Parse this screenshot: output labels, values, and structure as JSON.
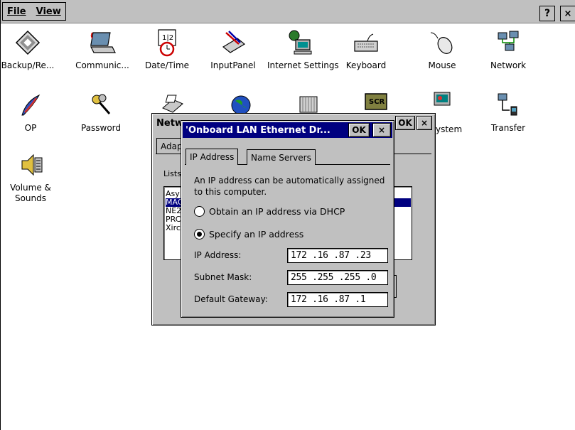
{
  "menubar": {
    "menus": [
      "File",
      "View"
    ],
    "help_label": "?",
    "close_label": "×"
  },
  "desktop_icons": [
    {
      "label": "Backup/Re...",
      "icon": "floppy-disk-icon"
    },
    {
      "label": "Communic...",
      "icon": "laptop-icon"
    },
    {
      "label": "Date/Time",
      "icon": "calendar-clock-icon"
    },
    {
      "label": "InputPanel",
      "icon": "keyboard-pen-icon"
    },
    {
      "label": "Internet Settings",
      "icon": "globe-computer-icon"
    },
    {
      "label": "Keyboard",
      "icon": "keyboard-icon"
    },
    {
      "label": "Mouse",
      "icon": "mouse-icon"
    },
    {
      "label": "Network",
      "icon": "network-computers-icon"
    },
    {
      "label": "OP",
      "icon": "feather-icon"
    },
    {
      "label": "Password",
      "icon": "keys-icon"
    },
    {
      "label": "Transfer",
      "icon": "pc-connection-icon"
    },
    {
      "label": "Volume & Sounds",
      "icon": "speaker-icon"
    }
  ],
  "partial_desktop_labels": {
    "system_suffix": "ystem"
  },
  "network_window": {
    "title_prefix": "Netw",
    "ok_label": "OK",
    "close_label": "×",
    "tab_prefix": "Adap",
    "list_caption_prefix": "Lists",
    "adapter_items": [
      "Asy",
      "MAC",
      "NE2",
      "PRC",
      "Xirc"
    ]
  },
  "dialog": {
    "title": "'Onboard LAN Ethernet Dr...",
    "ok_label": "OK",
    "close_label": "×",
    "tabs": [
      "IP Address",
      "Name Servers"
    ],
    "description": "An IP address can be automatically assigned to this computer.",
    "radio_dhcp": "Obtain an IP address via DHCP",
    "radio_specify": "Specify an IP address",
    "selected_option": "specify",
    "fields": [
      {
        "label": "IP Address:",
        "value": "172 .16  .87  .23"
      },
      {
        "label": "Subnet Mask:",
        "value": "255 .255 .255 .0"
      },
      {
        "label": "Default Gateway:",
        "value": "172 .16  .87  .1"
      }
    ]
  },
  "colors": {
    "titlebar_active": "#000080",
    "face": "#c0c0c0",
    "list_selection": "#000080"
  }
}
